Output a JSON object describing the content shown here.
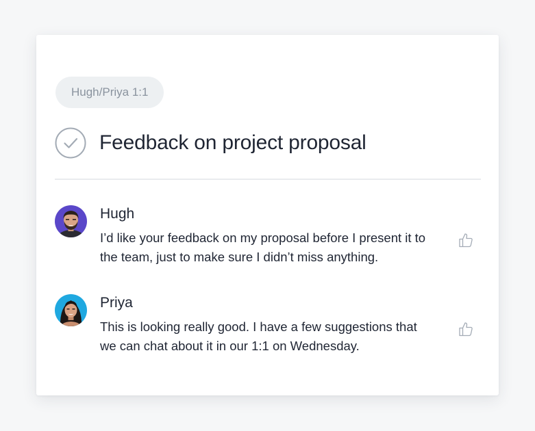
{
  "task": {
    "tag_label": "Hugh/Priya 1:1",
    "title": "Feedback on project proposal",
    "check_icon": "check-circle-icon"
  },
  "comments": [
    {
      "author": "Hugh",
      "text": "I’d like your feedback on my proposal before I present it to the team, just to make sure I didn’t miss anything.",
      "avatar_color": "#5a47c9",
      "like_icon": "thumbs-up-icon"
    },
    {
      "author": "Priya",
      "text": "This is looking really good. I have a few suggestions that we can chat about it in our 1:1 on Wednesday.",
      "avatar_color": "#1fa8e0",
      "like_icon": "thumbs-up-icon"
    }
  ],
  "colors": {
    "page_background": "#f6f7f8",
    "card_background": "#ffffff",
    "tag_background": "#edf0f2",
    "muted_icon": "#a3abb5",
    "text": "#1f2533"
  }
}
